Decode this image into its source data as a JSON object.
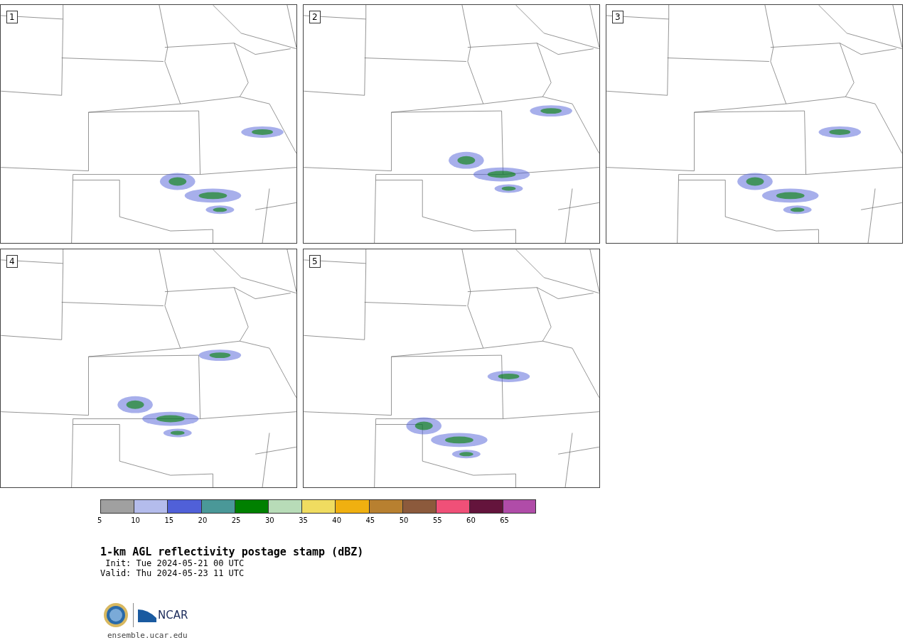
{
  "panels": [
    {
      "number": "1"
    },
    {
      "number": "2"
    },
    {
      "number": "3"
    },
    {
      "number": "4"
    },
    {
      "number": "5"
    }
  ],
  "colorbar": [
    {
      "label": "5",
      "color": "#a0a0a0"
    },
    {
      "label": "10",
      "color": "#b4bcec"
    },
    {
      "label": "15",
      "color": "#5060d8"
    },
    {
      "label": "20",
      "color": "#4a9898"
    },
    {
      "label": "25",
      "color": "#008000"
    },
    {
      "label": "30",
      "color": "#b8dcb8"
    },
    {
      "label": "35",
      "color": "#f0dc60"
    },
    {
      "label": "40",
      "color": "#f0b010"
    },
    {
      "label": "45",
      "color": "#b88030"
    },
    {
      "label": "50",
      "color": "#8c5a3c"
    },
    {
      "label": "55",
      "color": "#f05078"
    },
    {
      "label": "60",
      "color": "#64143c"
    },
    {
      "label": "65",
      "color": "#b04ca8"
    }
  ],
  "title": "1-km AGL reflectivity postage stamp (dBZ)",
  "init": " Init: Tue 2024-05-21 00 UTC",
  "valid": "Valid: Thu 2024-05-23 11 UTC",
  "logo_text": "NCAR",
  "site": "ensemble.ucar.edu"
}
